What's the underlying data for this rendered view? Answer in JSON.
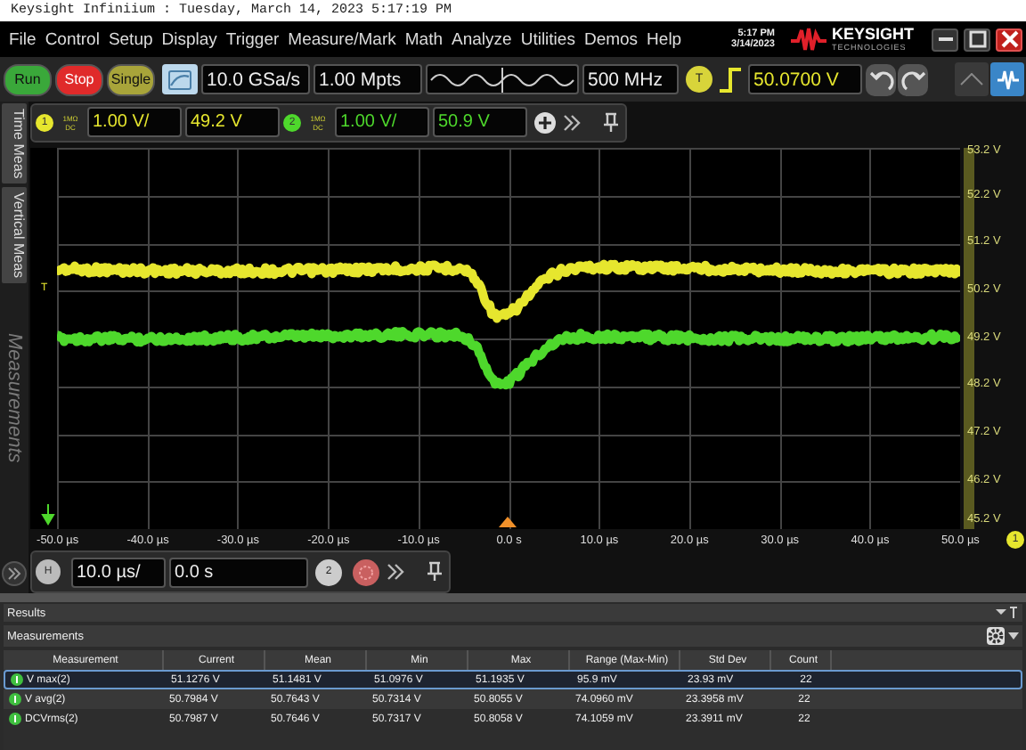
{
  "window": {
    "title": "Keysight Infiniium : Tuesday, March 14, 2023 5:17:19 PM"
  },
  "menu": [
    "File",
    "Control",
    "Setup",
    "Display",
    "Trigger",
    "Measure/Mark",
    "Math",
    "Analyze",
    "Utilities",
    "Demos",
    "Help"
  ],
  "clock": {
    "time": "5:17 PM",
    "date": "3/14/2023"
  },
  "logo": {
    "name": "KEYSIGHT",
    "tagline": "TECHNOLOGIES"
  },
  "acquisition": {
    "buttons": [
      {
        "label": "Run",
        "kind": "run"
      },
      {
        "label": "Stop",
        "kind": "stop"
      },
      {
        "label": "Single",
        "kind": "single"
      }
    ],
    "sample_rate": "10.0 GSa/s",
    "memory_depth": "1.00 Mpts",
    "bandwidth": "500 MHz",
    "trigger_badge": "T",
    "trigger_level": "50.0700 V"
  },
  "side_tabs": [
    "Time Meas",
    "Vertical Meas"
  ],
  "side_label": "Measurements",
  "channels": [
    {
      "number": "1",
      "impedance": "1MΩ",
      "coupling": "DC",
      "scale": "1.00 V/",
      "offset": "49.2 V",
      "color": "#e6e62e"
    },
    {
      "number": "2",
      "impedance": "1MΩ",
      "coupling": "DC",
      "scale": "1.00 V/",
      "offset": "50.9 V",
      "color": "#4ed82c"
    }
  ],
  "trigger_marker": "T",
  "y_axis": [
    "53.2 V",
    "52.2 V",
    "51.2 V",
    "50.2 V",
    "49.2 V",
    "48.2 V",
    "47.2 V",
    "46.2 V",
    "45.2 V"
  ],
  "x_axis": [
    "-50.0 µs",
    "-40.0 µs",
    "-30.0 µs",
    "-20.0 µs",
    "-10.0 µs",
    "0.0 s",
    "10.0 µs",
    "20.0 µs",
    "30.0 µs",
    "40.0 µs",
    "50.0 µs"
  ],
  "x_axis_badge": "1",
  "horizontal": {
    "badge": "H",
    "scale": "10.0 µs/",
    "position": "0.0 s",
    "zoom_badge": "2"
  },
  "results": {
    "title": "Results",
    "panel_title": "Measurements",
    "columns": [
      "Measurement",
      "Current",
      "Mean",
      "Min",
      "Max",
      "Range (Max-Min)",
      "Std Dev",
      "Count"
    ],
    "rows": [
      {
        "cells": [
          "V max(2)",
          "51.1276 V",
          "51.1481 V",
          "51.0976 V",
          "51.1935 V",
          "95.9 mV",
          "23.93 mV",
          "22"
        ],
        "selected": true
      },
      {
        "cells": [
          "V avg(2)",
          "50.7984 V",
          "50.7643 V",
          "50.7314 V",
          "50.8055 V",
          "74.0960 mV",
          "23.3958 mV",
          "22"
        ],
        "selected": false
      },
      {
        "cells": [
          "DCVrms(2)",
          "50.7987 V",
          "50.7646 V",
          "50.7317 V",
          "50.8058 V",
          "74.1059 mV",
          "23.3911 mV",
          "22"
        ],
        "selected": false
      }
    ]
  }
}
